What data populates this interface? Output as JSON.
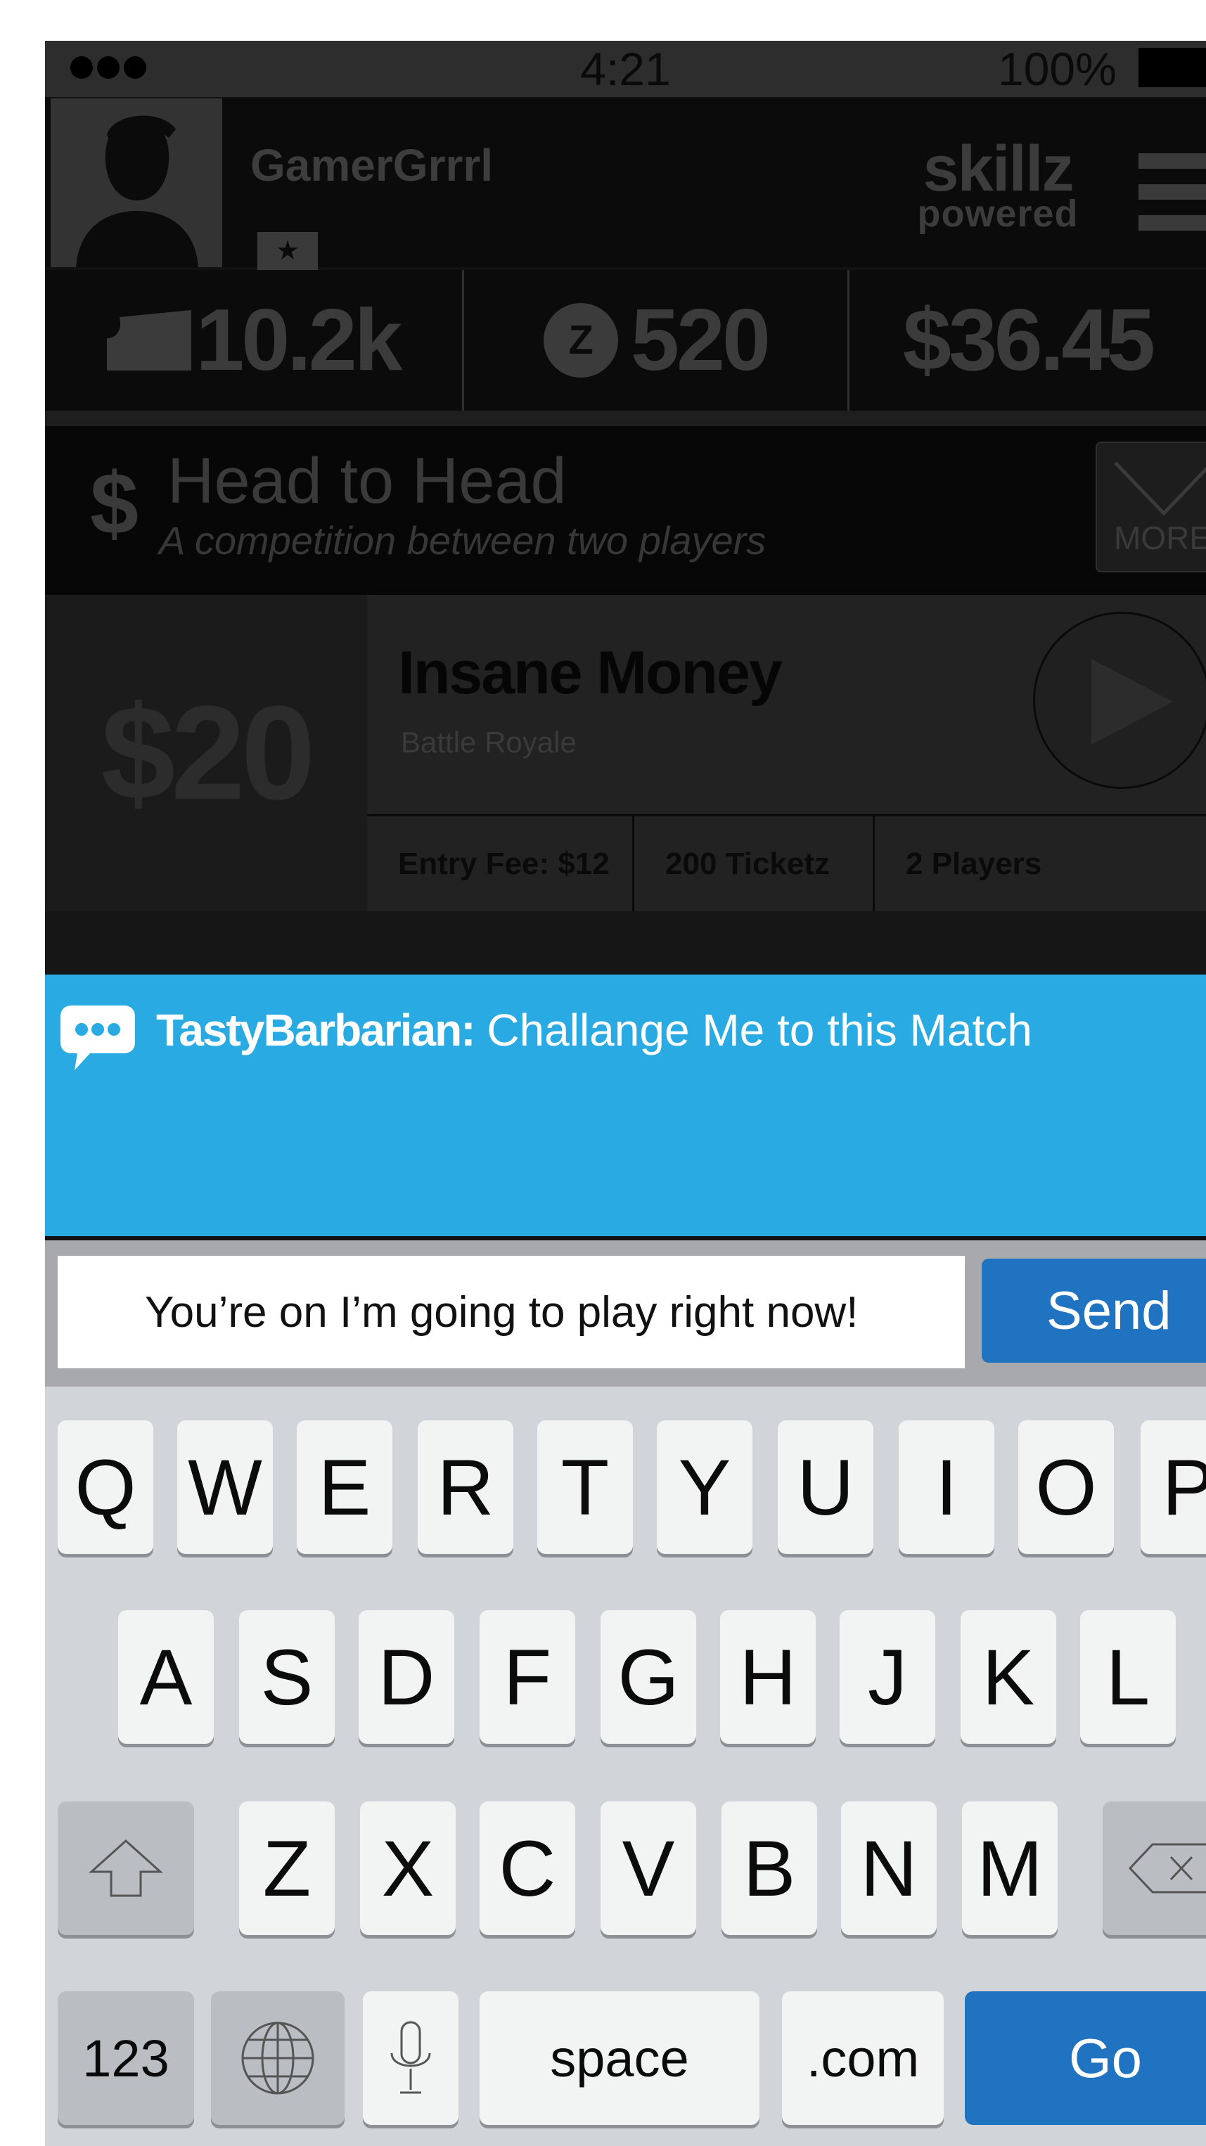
{
  "status_bar": {
    "time": "4:21",
    "battery": "100%"
  },
  "profile": {
    "username": "GamerGrrrl",
    "rank_badge": "★",
    "brand_top": "skillz",
    "brand_bottom": "powered"
  },
  "stats": {
    "tickets": "10.2k",
    "z_coin_letter": "Z",
    "z_coins": "520",
    "cash": "$36.45"
  },
  "mode": {
    "currency": "$",
    "title": "Head to Head",
    "subtitle": "A competition between two players",
    "more_label": "MORE"
  },
  "match": {
    "prize": "$20",
    "title": "Insane Money",
    "subtitle": "Battle Royale",
    "entry_fee": "Entry Fee: $12",
    "ticketz": "200 Ticketz",
    "players": "2 Players"
  },
  "chat": {
    "author": "TastyBarbarian:",
    "message": " Challange Me to this Match"
  },
  "composer": {
    "value": "You’re on I’m going to play right now!",
    "send_label": "Send"
  },
  "keyboard": {
    "row1": [
      "Q",
      "W",
      "E",
      "R",
      "T",
      "Y",
      "U",
      "I",
      "O",
      "P"
    ],
    "row2": [
      "A",
      "S",
      "D",
      "F",
      "G",
      "H",
      "J",
      "K",
      "L"
    ],
    "row3": [
      "Z",
      "X",
      "C",
      "V",
      "B",
      "N",
      "M"
    ],
    "numbers_label": "123",
    "space_label": "space",
    "dotcom_label": ".com",
    "go_label": "Go"
  },
  "colors": {
    "chat_blue": "#29aae2",
    "button_blue": "#1f73c1",
    "keyboard_bg": "#d1d4d8"
  }
}
